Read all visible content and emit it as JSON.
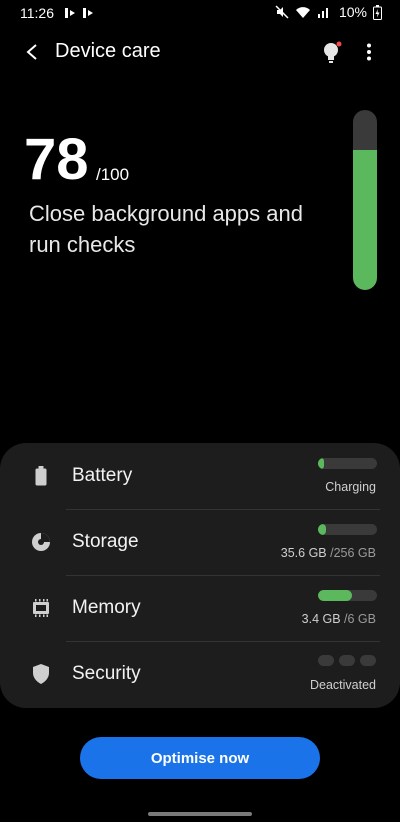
{
  "status_bar": {
    "time": "11:26",
    "battery_percent": "10%"
  },
  "header": {
    "title": "Device care",
    "back_icon": "back-arrow-icon",
    "tips_icon": "lightbulb-icon",
    "more_icon": "more-vertical-icon"
  },
  "score": {
    "value": "78",
    "max": "/100",
    "message": "Close background apps and run checks",
    "fill_fraction": 0.78
  },
  "items": [
    {
      "label": "Battery",
      "icon": "battery-icon",
      "status": "Charging",
      "level": 0.1
    },
    {
      "label": "Storage",
      "icon": "storage-pie-icon",
      "status_used": "35.6 GB",
      "status_total": " /256 GB",
      "level": 0.14
    },
    {
      "label": "Memory",
      "icon": "memory-chip-icon",
      "status_used": "3.4 GB",
      "status_total": " /6 GB",
      "level": 0.57
    },
    {
      "label": "Security",
      "icon": "shield-icon",
      "status": "Deactivated"
    }
  ],
  "actions": {
    "optimise_label": "Optimise now"
  },
  "colors": {
    "accent_blue": "#1a73e8",
    "bar_green": "#5cb85c",
    "card_bg": "#1d1d1d",
    "track_gray": "#3a3a3a"
  }
}
